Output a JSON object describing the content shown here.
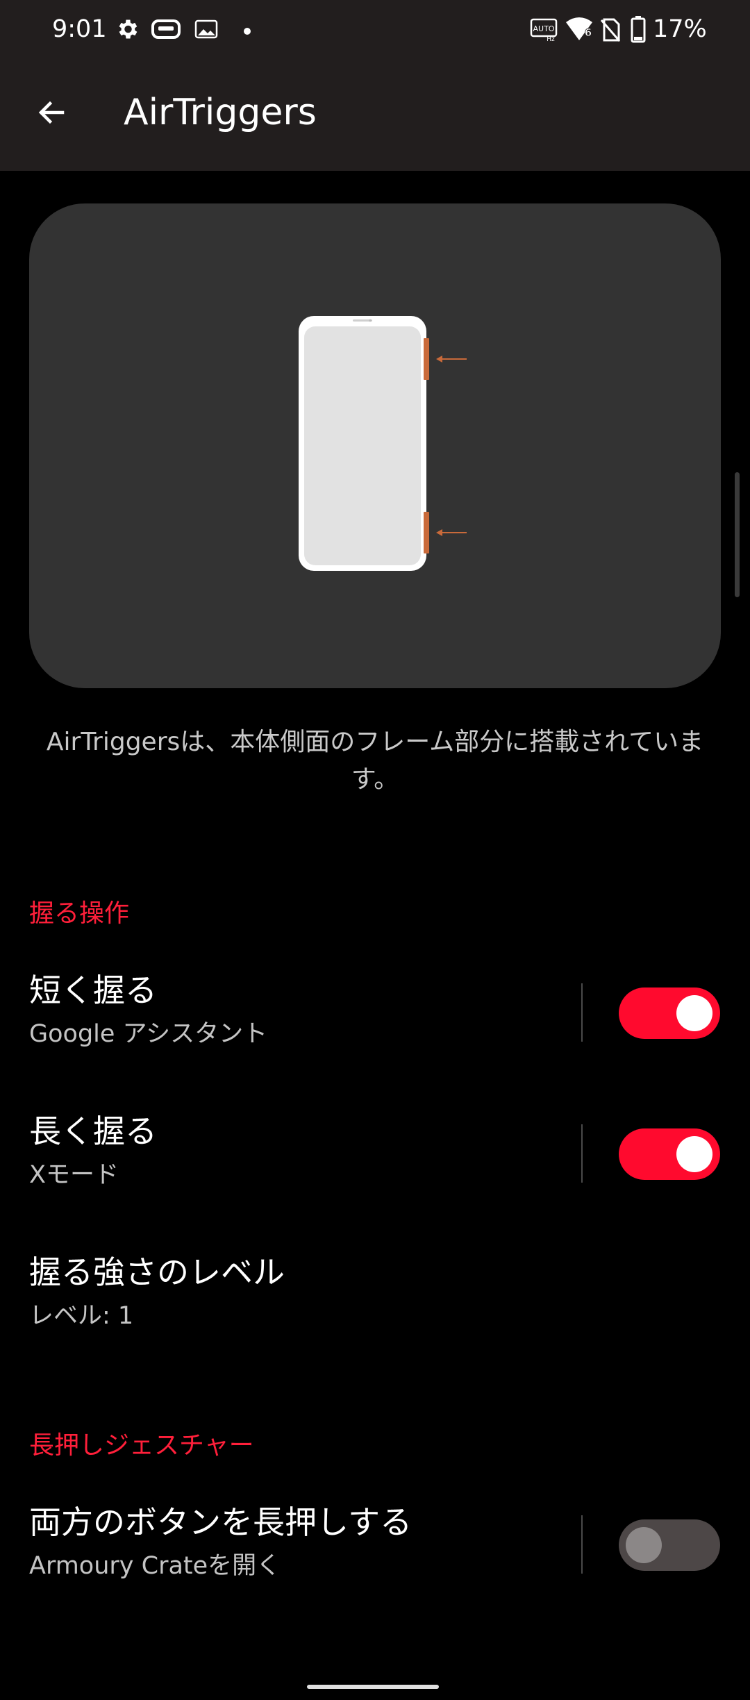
{
  "status_bar": {
    "time": "9:01",
    "left_icons": [
      "gear-icon",
      "game-controller-icon",
      "image-icon",
      "dot-icon"
    ],
    "right_icons": [
      "auto-refresh-rate-icon",
      "wifi-icon",
      "no-sim-icon",
      "battery-icon"
    ],
    "wifi_badge": "6",
    "battery": "17%"
  },
  "app_bar": {
    "back_icon": "arrow-left-icon",
    "title": "AirTriggers"
  },
  "illustration": {
    "description": "AirTriggersは、本体側面のフレーム部分に搭載されています。",
    "accent": "#c96a3a"
  },
  "sections": [
    {
      "header": "握る操作",
      "items": [
        {
          "title": "短く握る",
          "summary": "Google アシスタント",
          "toggle": true
        },
        {
          "title": "長く握る",
          "summary": "Xモード",
          "toggle": true
        },
        {
          "title": "握る強さのレベル",
          "summary": "レベル: 1"
        }
      ]
    },
    {
      "header": "長押しジェスチャー",
      "items": [
        {
          "title": "両方のボタンを長押しする",
          "summary": "Armoury Crateを開く",
          "toggle": false
        }
      ]
    }
  ],
  "colors": {
    "accent": "#ff0a2e",
    "section_header": "#ff1f3a",
    "app_bar_bg": "#221e1e",
    "card_bg": "#333333"
  }
}
